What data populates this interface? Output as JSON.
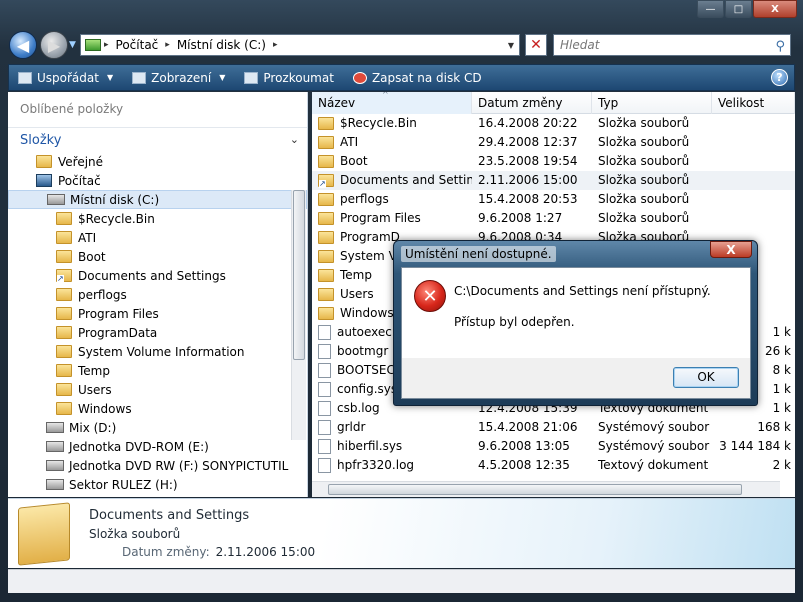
{
  "window": {
    "minimize": "—",
    "maximize": "□",
    "close": "X"
  },
  "nav": {
    "back": "◀",
    "forward": "▶"
  },
  "address": {
    "segments": [
      "Počítač",
      "Místní disk (C:)"
    ],
    "separator": "▸"
  },
  "search": {
    "placeholder": "Hledat"
  },
  "toolbar": {
    "items": [
      {
        "label": "Uspořádat",
        "icon": "organize-icon",
        "dropdown": true
      },
      {
        "label": "Zobrazení",
        "icon": "views-icon",
        "dropdown": true
      },
      {
        "label": "Prozkoumat",
        "icon": "explore-icon",
        "dropdown": false
      },
      {
        "label": "Zapsat na disk CD",
        "icon": "burn-cd-icon",
        "dropdown": false
      }
    ],
    "help": "?"
  },
  "sidebar": {
    "favorites": "Oblíbené položky",
    "folders_header": "Složky",
    "tree": [
      {
        "label": "Veřejné",
        "indent": 1,
        "type": "folder"
      },
      {
        "label": "Počítač",
        "indent": 1,
        "type": "computer"
      },
      {
        "label": "Místní disk (C:)",
        "indent": 2,
        "type": "drive",
        "selected": true
      },
      {
        "label": "$Recycle.Bin",
        "indent": 3,
        "type": "folder"
      },
      {
        "label": "ATI",
        "indent": 3,
        "type": "folder"
      },
      {
        "label": "Boot",
        "indent": 3,
        "type": "folder"
      },
      {
        "label": "Documents and Settings",
        "indent": 3,
        "type": "shortcut"
      },
      {
        "label": "perflogs",
        "indent": 3,
        "type": "folder"
      },
      {
        "label": "Program Files",
        "indent": 3,
        "type": "folder"
      },
      {
        "label": "ProgramData",
        "indent": 3,
        "type": "folder"
      },
      {
        "label": "System Volume Information",
        "indent": 3,
        "type": "folder"
      },
      {
        "label": "Temp",
        "indent": 3,
        "type": "folder"
      },
      {
        "label": "Users",
        "indent": 3,
        "type": "folder"
      },
      {
        "label": "Windows",
        "indent": 3,
        "type": "folder"
      },
      {
        "label": "Mix (D:)",
        "indent": 2,
        "type": "drive"
      },
      {
        "label": "Jednotka DVD-ROM (E:)",
        "indent": 2,
        "type": "drive"
      },
      {
        "label": "Jednotka DVD RW (F:) SONYPICTUTIL",
        "indent": 2,
        "type": "drive"
      },
      {
        "label": "Sektor RULEZ  (H:)",
        "indent": 2,
        "type": "drive"
      }
    ]
  },
  "columns": [
    "Název",
    "Datum změny",
    "Typ",
    "Velikost"
  ],
  "files": [
    {
      "name": "$Recycle.Bin",
      "date": "16.4.2008 20:22",
      "type": "Složka souborů",
      "size": "",
      "kind": "folder"
    },
    {
      "name": "ATI",
      "date": "29.4.2008 12:37",
      "type": "Složka souborů",
      "size": "",
      "kind": "folder"
    },
    {
      "name": "Boot",
      "date": "23.5.2008 19:54",
      "type": "Složka souborů",
      "size": "",
      "kind": "folder"
    },
    {
      "name": "Documents and Settings",
      "date": "2.11.2006 15:00",
      "type": "Složka souborů",
      "size": "",
      "kind": "shortcut",
      "selected": true
    },
    {
      "name": "perflogs",
      "date": "15.4.2008 20:53",
      "type": "Složka souborů",
      "size": "",
      "kind": "folder"
    },
    {
      "name": "Program Files",
      "date": "9.6.2008 1:27",
      "type": "Složka souborů",
      "size": "",
      "kind": "folder"
    },
    {
      "name": "ProgramD",
      "date": "9.6.2008 0:34",
      "type": "Složka souborů",
      "size": "",
      "kind": "folder"
    },
    {
      "name": "System Vo",
      "date": "",
      "type": "",
      "size": "",
      "kind": "folder"
    },
    {
      "name": "Temp",
      "date": "",
      "type": "",
      "size": "",
      "kind": "folder"
    },
    {
      "name": "Users",
      "date": "",
      "type": "",
      "size": "",
      "kind": "folder"
    },
    {
      "name": "Windows",
      "date": "",
      "type": "",
      "size": "",
      "kind": "folder"
    },
    {
      "name": "autoexec.b",
      "date": "",
      "type": "",
      "size": "1 k",
      "kind": "file"
    },
    {
      "name": "bootmgr",
      "date": "",
      "type": "",
      "size": "26 k",
      "kind": "file"
    },
    {
      "name": "BOOTSECT",
      "date": "",
      "type": "",
      "size": "8 k",
      "kind": "file"
    },
    {
      "name": "config.sys",
      "date": "",
      "type": "",
      "size": "1 k",
      "kind": "file"
    },
    {
      "name": "csb.log",
      "date": "12.4.2008 15:39",
      "type": "Textový dokument",
      "size": "1 k",
      "kind": "file"
    },
    {
      "name": "grldr",
      "date": "15.4.2008 21:06",
      "type": "Systémový soubor",
      "size": "168 k",
      "kind": "file"
    },
    {
      "name": "hiberfil.sys",
      "date": "9.6.2008 13:05",
      "type": "Systémový soubor",
      "size": "3 144 184 k",
      "kind": "file"
    },
    {
      "name": "hpfr3320.log",
      "date": "4.5.2008 12:35",
      "type": "Textový dokument",
      "size": "2 k",
      "kind": "file"
    }
  ],
  "details": {
    "name": "Documents and Settings",
    "type": "Složka souborů",
    "date_label": "Datum změny:",
    "date_value": "2.11.2006 15:00"
  },
  "dialog": {
    "title": "Umístění není dostupné.",
    "close": "X",
    "message": "C:\\Documents and Settings není přístupný.",
    "detail": "Přístup byl odepřen.",
    "ok": "OK",
    "icon": "error-icon"
  }
}
